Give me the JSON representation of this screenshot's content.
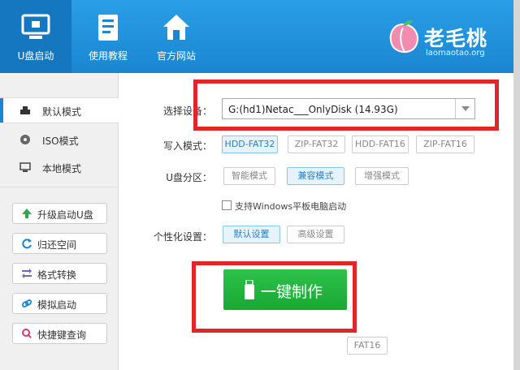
{
  "nav": {
    "items": [
      {
        "label": "U盘启动"
      },
      {
        "label": "使用教程"
      },
      {
        "label": "官方网站"
      }
    ]
  },
  "brand": {
    "name": "老毛桃",
    "site": "laomaotao.org"
  },
  "sidebar": {
    "modes": [
      {
        "label": "默认模式",
        "icon": "usb-drive-icon"
      },
      {
        "label": "ISO模式",
        "icon": "disc-icon"
      },
      {
        "label": "本地模式",
        "icon": "monitor-icon"
      }
    ],
    "tools": [
      {
        "label": "升级启动U盘",
        "icon": "arrow-up-icon"
      },
      {
        "label": "归还空间",
        "icon": "refresh-icon"
      },
      {
        "label": "格式转换",
        "icon": "swap-icon"
      },
      {
        "label": "模拟启动",
        "icon": "link-icon"
      },
      {
        "label": "快捷键查询",
        "icon": "search-icon"
      }
    ]
  },
  "form": {
    "device_label": "选择设备：",
    "device_value": "G:(hd1)Netac___OnlyDisk (14.93G)",
    "write_label": "写入模式：",
    "write_options": [
      "HDD-FAT32",
      "ZIP-FAT32",
      "HDD-FAT16",
      "ZIP-FAT16"
    ],
    "partition_label": "U盘分区：",
    "partition_options": [
      "智能模式",
      "兼容模式",
      "增强模式"
    ],
    "windows_tablet_label": "支持Windows平板电脑启动",
    "custom_label": "个性化设置：",
    "custom_options": [
      "默认设置",
      "高级设置"
    ],
    "make_button": "一键制作",
    "bottom_badge": "FAT16"
  },
  "colors": {
    "header": "#1a86d2",
    "accent": "#e0252b",
    "go": "#18a834"
  }
}
